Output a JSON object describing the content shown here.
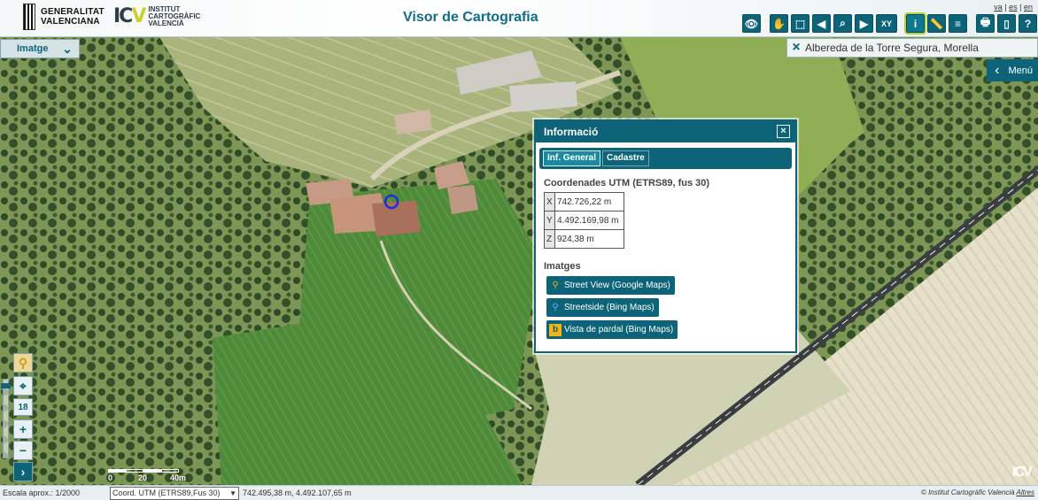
{
  "header": {
    "gva_line1": "GENERALITAT",
    "gva_line2": "VALENCIANA",
    "icv_line1": "INSTITUT",
    "icv_line2": "CARTOGRÀFIC",
    "icv_line3": "VALENCIÀ",
    "title": "Visor de Cartografia",
    "languages": [
      "va",
      "es",
      "en"
    ],
    "tools": [
      {
        "name": "eye-icon",
        "glyph": "👁"
      },
      {
        "name": "hand-pan-icon",
        "glyph": "✋"
      },
      {
        "name": "select-icon",
        "glyph": "⬚"
      },
      {
        "name": "arrow-left-icon",
        "glyph": "◀"
      },
      {
        "name": "zoom-box-icon",
        "glyph": "⌕"
      },
      {
        "name": "arrow-right-icon",
        "glyph": "▶"
      },
      {
        "name": "xy-icon",
        "glyph": "XY"
      },
      {
        "name": "info-icon",
        "glyph": "i"
      },
      {
        "name": "measure-icon",
        "glyph": "📏"
      },
      {
        "name": "layers-icon",
        "glyph": "≡"
      },
      {
        "name": "print-icon",
        "glyph": "🖶"
      },
      {
        "name": "mobile-icon",
        "glyph": "▯"
      },
      {
        "name": "help-icon",
        "glyph": "?"
      }
    ]
  },
  "map_controls": {
    "layer_select": "Imatge",
    "search_text": "Albereda de la Torre Segura, Morella",
    "menu_label": "Menú",
    "zoom_level": "18"
  },
  "scalebar": {
    "labels": [
      "0",
      "20",
      "40m"
    ]
  },
  "status": {
    "scale": "Escala aprox.: 1/2000",
    "coord_system": "Coord. UTM (ETRS89,Fus 30)",
    "coords": "742.495,38 m, 4.492.107,65 m",
    "copyright": "© Institut Cartogràfic Valencià",
    "altres": "Altres"
  },
  "popup": {
    "title": "Informació",
    "close": "×",
    "tabs": [
      "Inf. General",
      "Cadastre"
    ],
    "utm_title": "Coordenades UTM (ETRS89, fus 30)",
    "utm": [
      {
        "k": "X",
        "v": "742.726,22 m"
      },
      {
        "k": "Y",
        "v": "4.492.169,98 m"
      },
      {
        "k": "Z",
        "v": "924,38 m"
      }
    ],
    "images_title": "Imatges",
    "links": [
      "Street View (Google Maps)",
      "Streetside (Bing Maps)",
      "Vista de pardal (Bing Maps)"
    ]
  },
  "colors": {
    "accent": "#0d6478",
    "highlight": "#b9d33a"
  }
}
